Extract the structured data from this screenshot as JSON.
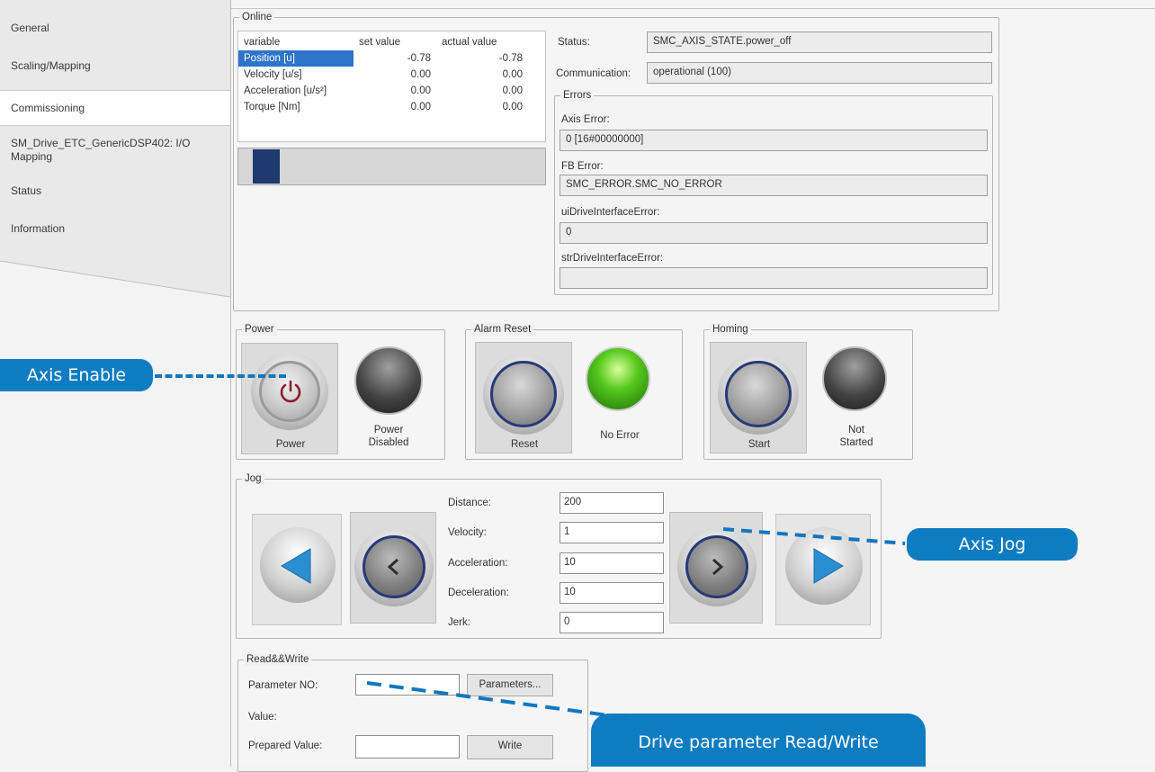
{
  "sidebar": {
    "items": [
      {
        "label": "General"
      },
      {
        "label": "Scaling/Mapping"
      },
      {
        "label": "Commissioning"
      },
      {
        "label": "SM_Drive_ETC_GenericDSP402: I/O Mapping"
      },
      {
        "label": "Status"
      },
      {
        "label": "Information"
      }
    ],
    "active_index": 2
  },
  "online": {
    "title": "Online",
    "table": {
      "headers": [
        "variable",
        "set value",
        "actual value"
      ],
      "rows": [
        {
          "variable": "Position [u]",
          "set": "-0.78",
          "actual": "-0.78"
        },
        {
          "variable": "Velocity [u/s]",
          "set": "0.00",
          "actual": "0.00"
        },
        {
          "variable": "Acceleration [u/s²]",
          "set": "0.00",
          "actual": "0.00"
        },
        {
          "variable": "Torque [Nm]",
          "set": "0.00",
          "actual": "0.00"
        }
      ],
      "selected_row": 0
    },
    "slider_position": 0.05,
    "status_label": "Status:",
    "status_value": "SMC_AXIS_STATE.power_off",
    "communication_label": "Communication:",
    "communication_value": "operational (100)",
    "errors": {
      "title": "Errors",
      "axis_error_label": "Axis Error:",
      "axis_error_value": "0 [16#00000000]",
      "fb_error_label": "FB Error:",
      "fb_error_value": "SMC_ERROR.SMC_NO_ERROR",
      "drive_if_error_label": "uiDriveInterfaceError:",
      "drive_if_error_value": "0",
      "str_drive_if_error_label": "strDriveInterfaceError:",
      "str_drive_if_error_value": ""
    }
  },
  "power": {
    "title": "Power",
    "button_label": "Power",
    "lamp_label_line1": "Power",
    "lamp_label_line2": "Disabled"
  },
  "alarm_reset": {
    "title": "Alarm Reset",
    "button_label": "Reset",
    "lamp_label": "No Error",
    "lamp_color": "#55c81d"
  },
  "homing": {
    "title": "Homing",
    "button_label": "Start",
    "lamp_label_line1": "Not",
    "lamp_label_line2": "Started"
  },
  "jog": {
    "title": "Jog",
    "distance_label": "Distance:",
    "distance_value": "200",
    "velocity_label": "Velocity:",
    "velocity_value": "1",
    "acceleration_label": "Acceleration:",
    "acceleration_value": "10",
    "deceleration_label": "Deceleration:",
    "deceleration_value": "10",
    "jerk_label": "Jerk:",
    "jerk_value": "0",
    "arrow_color": "#2b8ed0",
    "icons": [
      "jog-fast-left-icon",
      "jog-step-left-icon",
      "jog-step-right-icon",
      "jog-fast-right-icon"
    ]
  },
  "read_write": {
    "title": "Read&&Write",
    "param_no_label": "Parameter NO:",
    "param_no_value": "",
    "parameters_button": "Parameters...",
    "value_label": "Value:",
    "prepared_value_label": "Prepared Value:",
    "prepared_value": "",
    "write_button": "Write"
  },
  "callouts": {
    "axis_enable": "Axis Enable",
    "axis_jog": "Axis Jog",
    "drive_param": "Drive parameter Read/Write",
    "color": "#0e7cc1"
  }
}
